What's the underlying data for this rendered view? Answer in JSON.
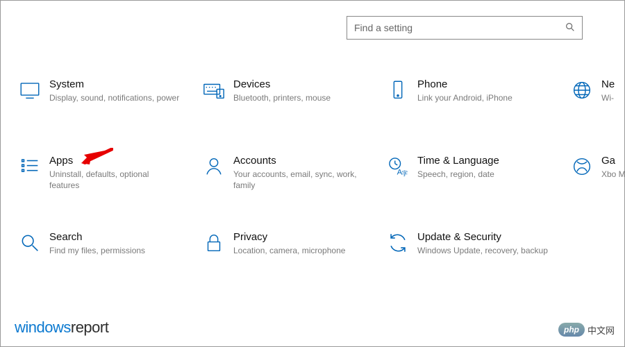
{
  "search": {
    "placeholder": "Find a setting"
  },
  "categories": [
    {
      "key": "system",
      "title": "System",
      "desc": "Display, sound, notifications, power"
    },
    {
      "key": "devices",
      "title": "Devices",
      "desc": "Bluetooth, printers, mouse"
    },
    {
      "key": "phone",
      "title": "Phone",
      "desc": "Link your Android, iPhone"
    },
    {
      "key": "network",
      "title": "Ne",
      "desc": "Wi-"
    },
    {
      "key": "apps",
      "title": "Apps",
      "desc": "Uninstall, defaults, optional features"
    },
    {
      "key": "accounts",
      "title": "Accounts",
      "desc": "Your accounts, email, sync, work, family"
    },
    {
      "key": "time",
      "title": "Time & Language",
      "desc": "Speech, region, date"
    },
    {
      "key": "gaming",
      "title": "Ga",
      "desc": "Xbo Mo"
    },
    {
      "key": "search",
      "title": "Search",
      "desc": "Find my files, permissions"
    },
    {
      "key": "privacy",
      "title": "Privacy",
      "desc": "Location, camera, microphone"
    },
    {
      "key": "update",
      "title": "Update & Security",
      "desc": "Windows Update, recovery, backup"
    }
  ],
  "annotation": {
    "arrow_target": "apps"
  },
  "watermark_left": {
    "part1": "windows",
    "part2": "report"
  },
  "watermark_right": {
    "pill": "php",
    "text": "中文网"
  },
  "colors": {
    "accent": "#0066b8",
    "arrow": "#e60000"
  }
}
